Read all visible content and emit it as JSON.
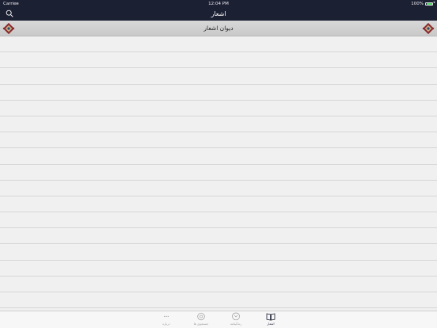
{
  "status_bar": {
    "carrier": "Carrier",
    "time": "12:04 PM",
    "battery": "100%"
  },
  "nav": {
    "title": "اشعار"
  },
  "section": {
    "title": "دیوان اشعار"
  },
  "list": {
    "rows": [
      "",
      "",
      "",
      "",
      "",
      "",
      "",
      "",
      "",
      "",
      "",
      "",
      "",
      "",
      "",
      "",
      ""
    ]
  },
  "tabs": [
    {
      "label": "درباره",
      "icon": "info-icon",
      "active": false
    },
    {
      "label": "جستجوی ها",
      "icon": "search-circle-icon",
      "active": false
    },
    {
      "label": "زندگینامه",
      "icon": "biography-icon",
      "active": false
    },
    {
      "label": "اشعار",
      "icon": "book-icon",
      "active": true
    }
  ],
  "colors": {
    "nav_background": "#1c2033",
    "header_background": "#cdcdcd",
    "list_background": "#f0f0f0",
    "battery_fill": "#4cd964"
  }
}
